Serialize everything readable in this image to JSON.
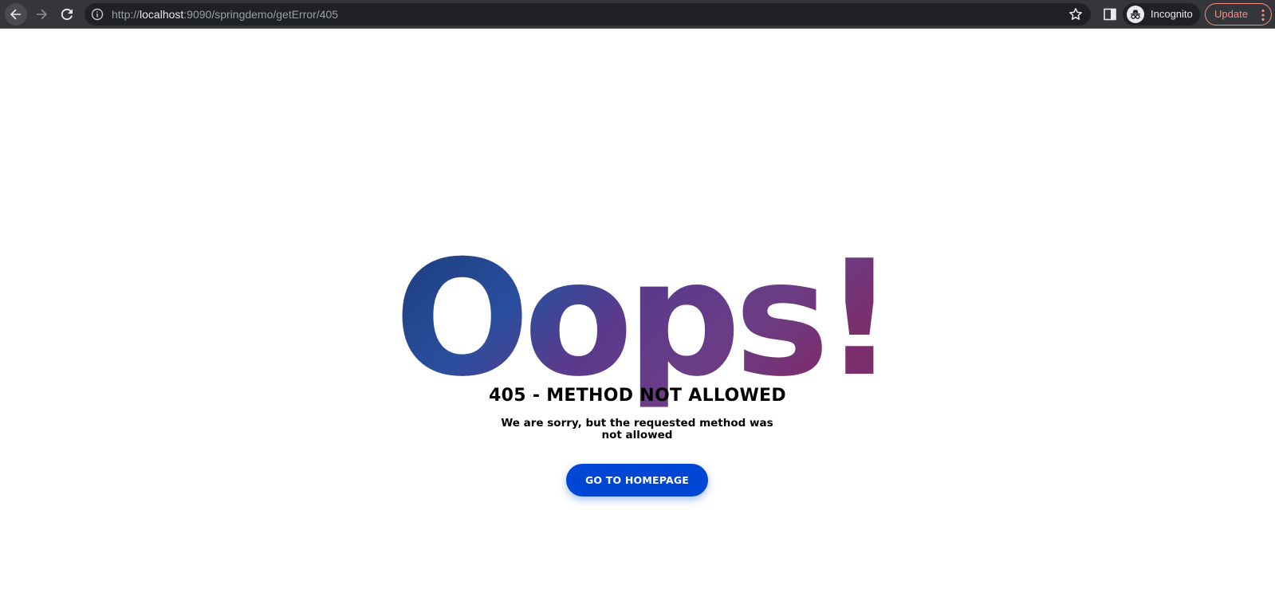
{
  "browser": {
    "url_scheme": "http://",
    "url_host": "localhost",
    "url_rest": ":9090/springdemo/getError/405",
    "profile_label": "Incognito",
    "update_label": "Update",
    "icons": {
      "back": "arrow-back-icon",
      "forward": "arrow-forward-icon",
      "reload": "reload-icon",
      "info": "info-icon",
      "bookmark": "star-icon",
      "side_panel": "side-panel-icon",
      "incognito": "incognito-icon",
      "menu": "more-vert-icon"
    },
    "colors": {
      "toolbar": "#35363a",
      "omnibox": "#202124",
      "update_accent": "#f28b82"
    }
  },
  "page": {
    "oops_text": "Oops!",
    "heading": "405 - METHOD NOT ALLOWED",
    "message": "We are sorry, but the requested method was not allowed",
    "button_label": "GO TO HOMEPAGE",
    "colors": {
      "button": "#0046d5",
      "text": "#000000",
      "oops_fill_start": "#1b3a7a",
      "oops_fill_mid": "#5a3a8c",
      "oops_fill_end": "#7a2e6e"
    }
  }
}
